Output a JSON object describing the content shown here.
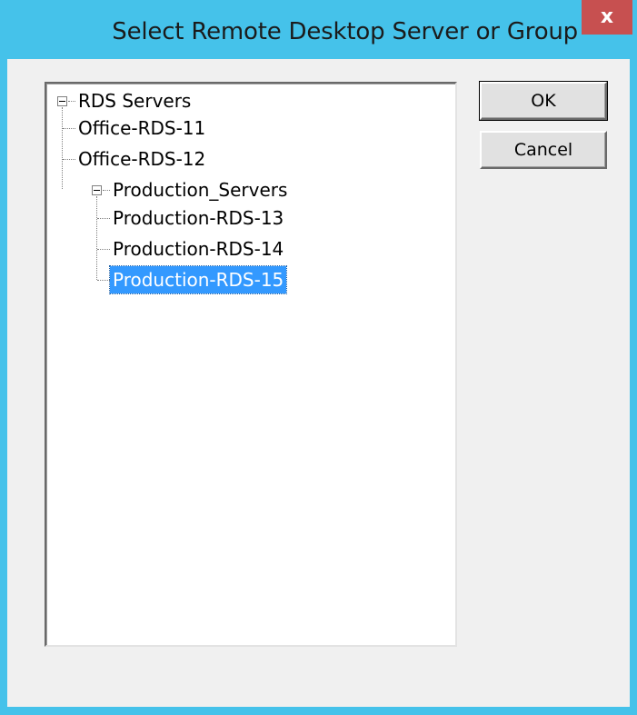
{
  "window": {
    "title": "Select Remote Desktop Server or Group",
    "close_label": "x",
    "frame_color": "#45c2ea",
    "close_color": "#c75050"
  },
  "tree": {
    "root": "RDS Servers",
    "items": [
      {
        "label": "Office-RDS-11"
      },
      {
        "label": "Office-RDS-12"
      }
    ],
    "group": {
      "label": "Production_Servers",
      "items": [
        {
          "label": "Production-RDS-13"
        },
        {
          "label": "Production-RDS-14"
        },
        {
          "label": "Production-RDS-15",
          "selected": true
        }
      ]
    },
    "selection_color": "#3399ff"
  },
  "buttons": {
    "ok_label": "OK",
    "cancel_label": "Cancel"
  }
}
